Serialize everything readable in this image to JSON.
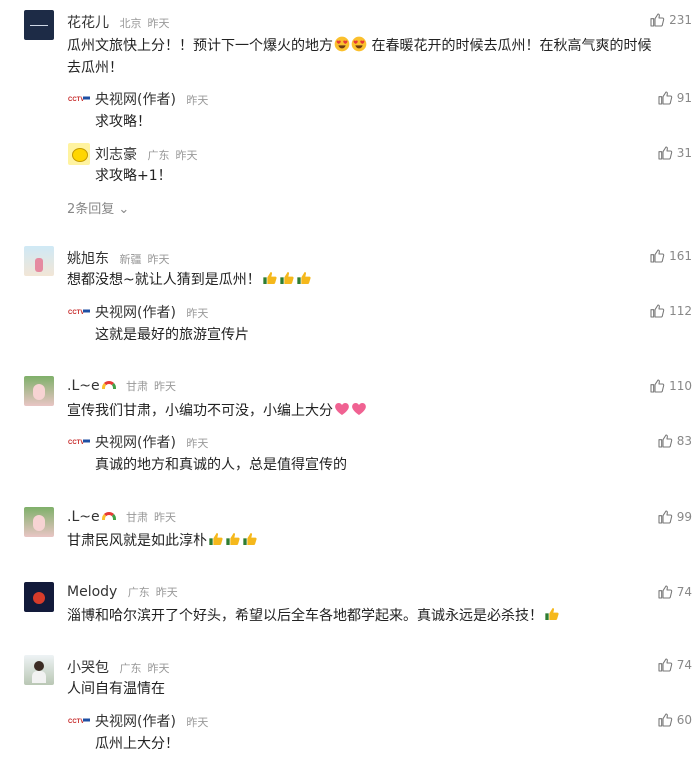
{
  "comments": [
    {
      "name": "花花儿",
      "location": "北京",
      "time": "昨天",
      "likes": "231",
      "text_line1": "瓜州文旅快上分！！预计下一个爆火的地方",
      "text_after_emoji": "在春暖花开的时候去瓜州！在秋高气爽的时候",
      "text_line2": "去瓜州！",
      "emoji": [
        "heart-eyes",
        "heart-eyes"
      ],
      "replies": [
        {
          "name": "央视网(作者)",
          "time": "昨天",
          "likes": "91",
          "text": "求攻略！"
        },
        {
          "name": "刘志豪",
          "location": "广东",
          "time": "昨天",
          "likes": "31",
          "text": "求攻略+1！"
        }
      ],
      "more_replies": "2条回复"
    },
    {
      "name": "姚旭东",
      "location": "新疆",
      "time": "昨天",
      "likes": "161",
      "text": "想都没想~就让人猜到是瓜州！",
      "emoji": [
        "thumbs-up",
        "thumbs-up",
        "thumbs-up"
      ],
      "replies": [
        {
          "name": "央视网(作者)",
          "time": "昨天",
          "likes": "112",
          "text": "这就是最好的旅游宣传片"
        }
      ]
    },
    {
      "name": ".L~e",
      "location": "甘肃",
      "time": "昨天",
      "likes": "110",
      "text": "宣传我们甘肃，小编功不可没，小编上大分",
      "emoji": [
        "heart",
        "heart"
      ],
      "replies": [
        {
          "name": "央视网(作者)",
          "time": "昨天",
          "likes": "83",
          "text": "真诚的地方和真诚的人，总是值得宣传的"
        }
      ]
    },
    {
      "name": ".L~e",
      "location": "甘肃",
      "time": "昨天",
      "likes": "99",
      "text": "甘肃民风就是如此淳朴",
      "emoji": [
        "thumbs-up",
        "thumbs-up",
        "thumbs-up"
      ]
    },
    {
      "name": "Melody",
      "location": "广东",
      "time": "昨天",
      "likes": "74",
      "text": "淄博和哈尔滨开了个好头，希望以后全车各地都学起来。真诚永远是必杀技！",
      "emoji": [
        "thumbs-up"
      ]
    },
    {
      "name": "小哭包",
      "location": "广东",
      "time": "昨天",
      "likes": "74",
      "text": "人间自有温情在",
      "replies": [
        {
          "name": "央视网(作者)",
          "time": "昨天",
          "likes": "60",
          "text": "瓜州上大分！"
        }
      ]
    }
  ],
  "colors": {
    "text": "#222222",
    "meta": "#999999",
    "like": "#888888"
  }
}
